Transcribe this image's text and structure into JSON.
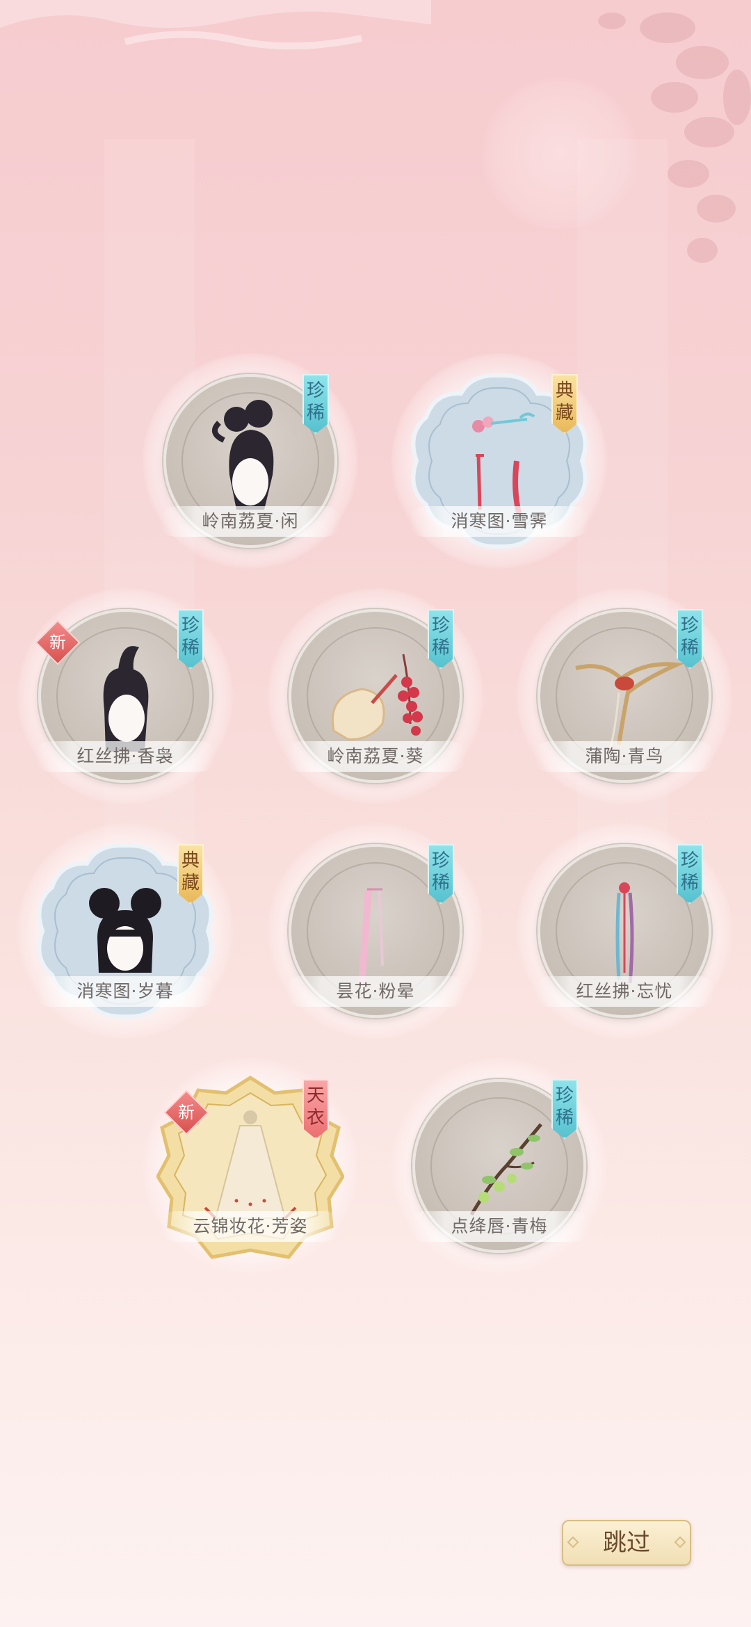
{
  "items": [
    {
      "name": "岭南荔夏·闲",
      "rarity": "珍稀",
      "rarity_color": "#56c2cf",
      "new_badge": "",
      "frame": "round",
      "icon": "hairstyle-icon"
    },
    {
      "name": "消寒图·雪霁",
      "rarity": "典藏",
      "rarity_color": "#e9b95a",
      "new_badge": "",
      "frame": "flower",
      "icon": "hairpin-icon"
    },
    {
      "name": "红丝拂·香袅",
      "rarity": "珍稀",
      "rarity_color": "#56c2cf",
      "new_badge": "新",
      "frame": "round",
      "icon": "hairstyle-icon"
    },
    {
      "name": "岭南荔夏·葵",
      "rarity": "珍稀",
      "rarity_color": "#56c2cf",
      "new_badge": "",
      "frame": "round",
      "icon": "fan-icon"
    },
    {
      "name": "蒲陶·青鸟",
      "rarity": "珍稀",
      "rarity_color": "#56c2cf",
      "new_badge": "",
      "frame": "round",
      "icon": "bird-icon"
    },
    {
      "name": "消寒图·岁暮",
      "rarity": "典藏",
      "rarity_color": "#e9b95a",
      "new_badge": "",
      "frame": "flower",
      "icon": "hairstyle-icon"
    },
    {
      "name": "昙花·粉晕",
      "rarity": "珍稀",
      "rarity_color": "#56c2cf",
      "new_badge": "",
      "frame": "round",
      "icon": "ribbon-icon"
    },
    {
      "name": "红丝拂·忘忧",
      "rarity": "珍稀",
      "rarity_color": "#56c2cf",
      "new_badge": "",
      "frame": "round",
      "icon": "tassel-icon"
    },
    {
      "name": "云锦妆花·芳姿",
      "rarity": "天衣",
      "rarity_color": "#ec6f72",
      "new_badge": "新",
      "frame": "gold",
      "icon": "dress-icon"
    },
    {
      "name": "点绛唇·青梅",
      "rarity": "珍稀",
      "rarity_color": "#56c2cf",
      "new_badge": "",
      "frame": "round",
      "icon": "plum-branch-icon"
    }
  ],
  "skip_label": "跳过"
}
